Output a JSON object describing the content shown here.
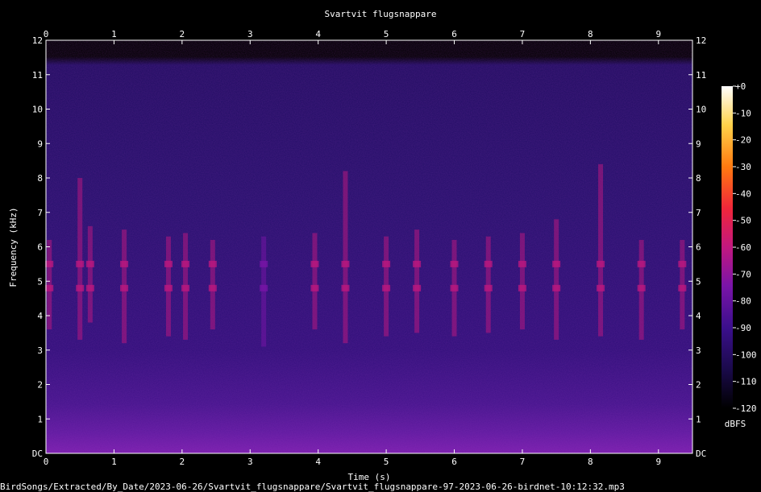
{
  "chart_data": {
    "type": "heatmap",
    "title": "Svartvit flugsnappare",
    "xlabel": "Time (s)",
    "ylabel": "Frequency (kHz)",
    "xlim": [
      0,
      9.5
    ],
    "ylim": [
      0,
      12
    ],
    "x_ticks": [
      "0",
      "1",
      "2",
      "3",
      "4",
      "5",
      "6",
      "7",
      "8",
      "9"
    ],
    "y_ticks": [
      "DC",
      "1",
      "2",
      "3",
      "4",
      "5",
      "6",
      "7",
      "8",
      "9",
      "10",
      "11",
      "12"
    ],
    "colorbar": {
      "label": "dBFS",
      "ticks": [
        "+0",
        "-10",
        "-20",
        "-30",
        "-40",
        "-50",
        "-60",
        "-70",
        "-80",
        "-90",
        "-100",
        "-110",
        "-120"
      ],
      "range": [
        -120,
        0
      ],
      "palette": [
        "#000000",
        "#1a0a4a",
        "#3b0f8c",
        "#7a14a8",
        "#c2187f",
        "#f0263a",
        "#ff7a10",
        "#ffd24a",
        "#ffffff"
      ]
    },
    "background_level_dbfs": -95,
    "calls": [
      {
        "t": 0.05,
        "f_low": 3.6,
        "f_high": 6.2,
        "peak_dbfs": -72
      },
      {
        "t": 0.5,
        "f_low": 3.3,
        "f_high": 8.0,
        "peak_dbfs": -68
      },
      {
        "t": 0.65,
        "f_low": 3.8,
        "f_high": 6.6,
        "peak_dbfs": -75
      },
      {
        "t": 1.15,
        "f_low": 3.2,
        "f_high": 6.5,
        "peak_dbfs": -72
      },
      {
        "t": 1.8,
        "f_low": 3.4,
        "f_high": 6.3,
        "peak_dbfs": -70
      },
      {
        "t": 2.05,
        "f_low": 3.3,
        "f_high": 6.4,
        "peak_dbfs": -74
      },
      {
        "t": 2.45,
        "f_low": 3.6,
        "f_high": 6.2,
        "peak_dbfs": -73
      },
      {
        "t": 3.2,
        "f_low": 3.1,
        "f_high": 6.3,
        "peak_dbfs": -76
      },
      {
        "t": 3.95,
        "f_low": 3.6,
        "f_high": 6.4,
        "peak_dbfs": -70
      },
      {
        "t": 4.4,
        "f_low": 3.2,
        "f_high": 8.2,
        "peak_dbfs": -68
      },
      {
        "t": 5.0,
        "f_low": 3.4,
        "f_high": 6.3,
        "peak_dbfs": -73
      },
      {
        "t": 5.45,
        "f_low": 3.5,
        "f_high": 6.5,
        "peak_dbfs": -72
      },
      {
        "t": 6.0,
        "f_low": 3.4,
        "f_high": 6.2,
        "peak_dbfs": -71
      },
      {
        "t": 6.5,
        "f_low": 3.5,
        "f_high": 6.3,
        "peak_dbfs": -72
      },
      {
        "t": 7.0,
        "f_low": 3.6,
        "f_high": 6.4,
        "peak_dbfs": -70
      },
      {
        "t": 7.5,
        "f_low": 3.3,
        "f_high": 6.8,
        "peak_dbfs": -72
      },
      {
        "t": 8.15,
        "f_low": 3.4,
        "f_high": 8.4,
        "peak_dbfs": -68
      },
      {
        "t": 8.75,
        "f_low": 3.3,
        "f_high": 6.2,
        "peak_dbfs": -73
      },
      {
        "t": 9.35,
        "f_low": 3.6,
        "f_high": 6.2,
        "peak_dbfs": -74
      }
    ]
  },
  "footer": {
    "file_path": "BirdSongs/Extracted/By_Date/2023-06-26/Svartvit_flugsnappare/Svartvit_flugsnappare-97-2023-06-26-birdnet-10:12:32.mp3"
  }
}
